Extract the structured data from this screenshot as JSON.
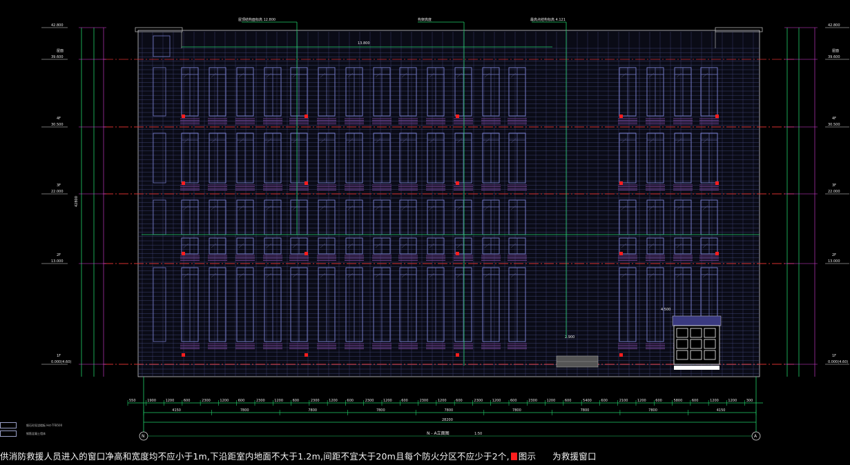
{
  "drawing": {
    "title": "N - A立面图",
    "scale": "1:50",
    "axis_left": "N",
    "axis_right": "A",
    "top_notes": [
      "屋顶结构面标高 12.800",
      "构架高度",
      "最高点结构标高 4.121"
    ],
    "parapet_label": "13.800",
    "canopy_label": "4.500",
    "ramp_label": "2.900"
  },
  "levels": [
    {
      "name": "",
      "elev": "42.800"
    },
    {
      "name": "屋面",
      "elev": "39.600"
    },
    {
      "name": "4F",
      "elev": "30.500"
    },
    {
      "name": "3F",
      "elev": "22.000"
    },
    {
      "name": "2F",
      "elev": "13.000"
    },
    {
      "name": "1F",
      "elev": "0.000(4.60)"
    }
  ],
  "dims": {
    "total_height": "42800",
    "total_width": "28200",
    "bays": [
      "4150",
      "7800",
      "7800",
      "7800",
      "7800",
      "7800",
      "7800",
      "7800",
      "4150"
    ],
    "opening_row": [
      "550",
      "1900",
      "1200",
      "600",
      "2300",
      "1200",
      "600",
      "2300",
      "1200",
      "600",
      "2300",
      "1200",
      "600",
      "2300",
      "1200",
      "600",
      "2300",
      "1200",
      "600",
      "2300",
      "1200",
      "600",
      "2300",
      "1200",
      "600",
      "5400",
      "600",
      "2100",
      "1200",
      "600",
      "5800",
      "600",
      "1200",
      "1200",
      "300"
    ]
  },
  "legend": [
    "细石砼现浇楼板 Hst-TFB500",
    "钢筋混凝土墙体"
  ],
  "footer_note": {
    "text": "供消防救援人员进入的窗口净高和宽度均不应小于1m,下沿距室内地面不大于1.2m,间距不宜大于20m且每个防火分区不应少于2个,",
    "figure_word": "图示",
    "tail": "为救援窗口"
  },
  "colors": {
    "background": "#000000",
    "grid": "#4a4f86",
    "window_frame": "#7f86d8",
    "level_line": "#d83030",
    "dimension": "#21d16a",
    "elevation_mark": "#e040e0",
    "rescue_marker": "#ff1e1e"
  }
}
